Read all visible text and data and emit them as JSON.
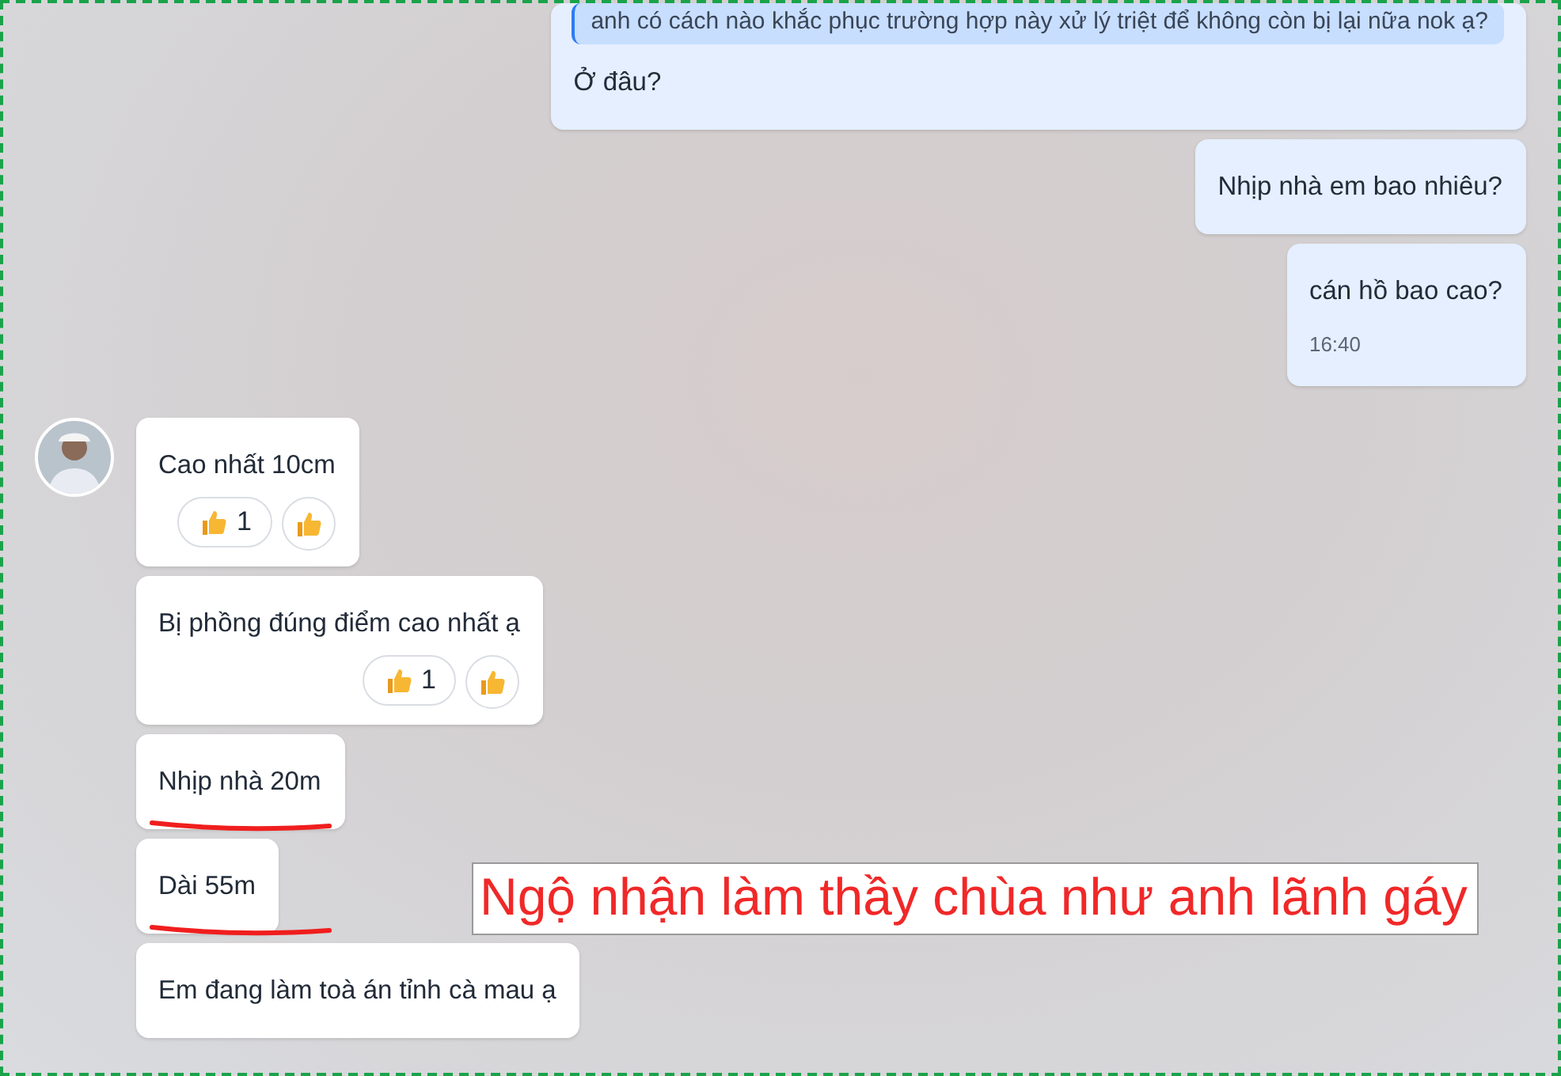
{
  "messages": [
    {
      "kind": "outgoing",
      "quote": "anh có cách nào khắc phục trường hợp này xử lý triệt để không còn bị lại nữa nok ạ?",
      "text": "Ở đâu?",
      "underlined": false
    },
    {
      "kind": "outgoing",
      "text": "Nhịp nhà em bao nhiêu?",
      "underlined": false
    },
    {
      "kind": "outgoing",
      "text": "cán hồ bao cao?",
      "time": "16:40",
      "underlined": false
    },
    {
      "kind": "incoming",
      "avatar": true,
      "text": "Cao nhất 10cm",
      "reaction_count": "1",
      "underlined": false
    },
    {
      "kind": "incoming",
      "avatar": false,
      "text": "Bị phồng đúng điểm cao nhất ạ",
      "reaction_count": "1",
      "underlined": false
    },
    {
      "kind": "incoming",
      "avatar": false,
      "text": "Nhịp nhà 20m",
      "underlined": true
    },
    {
      "kind": "incoming",
      "avatar": false,
      "text": "Dài 55m",
      "underlined": true
    },
    {
      "kind": "incoming",
      "avatar": false,
      "text": "Em đang làm toà án tỉnh cà mau ạ",
      "underlined": false
    }
  ],
  "annotation": {
    "text": "Ngộ nhận làm thầy chùa như anh lãnh gáy"
  }
}
